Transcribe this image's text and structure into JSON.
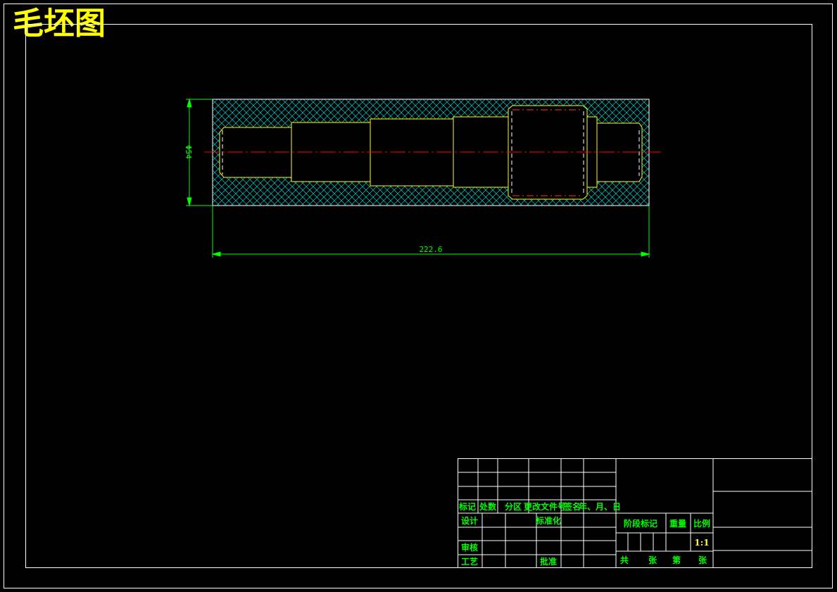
{
  "drawing_title": "毛坯图",
  "dimensions": {
    "diameter": "Φ54",
    "length": "222.6"
  },
  "title_block": {
    "headers": [
      "标记",
      "处数",
      "分区",
      "更改文件号",
      "签名",
      "年、月、日"
    ],
    "design": "设计",
    "standardization": "标准化",
    "review": "审核",
    "process": "工艺",
    "approval": "批准",
    "stage_mark": "阶段标记",
    "weight": "重量",
    "scale": "比例",
    "scale_value": "1:1",
    "total": "共",
    "sheets": "张",
    "sheet_no": "第",
    "sheet": "张"
  },
  "colors": {
    "background": "#000000",
    "frame": "#ffffff",
    "blank_outline": "#ffffff",
    "hatch": "#00cccc",
    "part_outline": "#ffff00",
    "centerline": "#ff0000",
    "dimension": "#00ff00",
    "title_text": "#ffff00"
  }
}
